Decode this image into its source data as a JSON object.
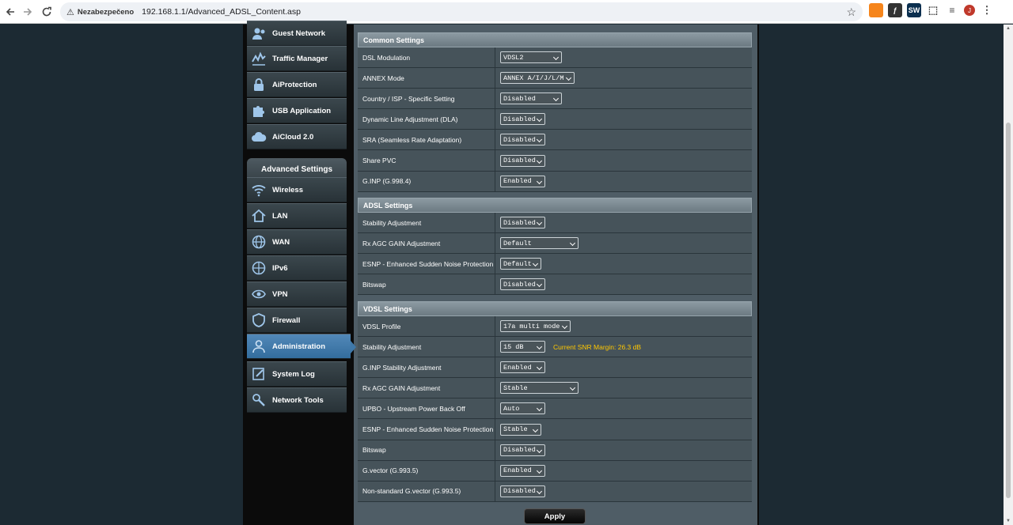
{
  "browser": {
    "security_label": "Nezabezpečeno",
    "url": "192.168.1.1/Advanced_ADSL_Content.asp",
    "avatar_initial": "J",
    "ext_labels": [
      "",
      "",
      "SW",
      "",
      ""
    ]
  },
  "sidebar": {
    "top_items": [
      {
        "label": "Guest Network",
        "icon": "guest-network-icon"
      },
      {
        "label": "Traffic Manager",
        "icon": "traffic-manager-icon"
      },
      {
        "label": "AiProtection",
        "icon": "lock-icon"
      },
      {
        "label": "USB Application",
        "icon": "puzzle-icon"
      },
      {
        "label": "AiCloud 2.0",
        "icon": "cloud-icon"
      }
    ],
    "advanced_header": "Advanced Settings",
    "advanced_items": [
      {
        "label": "Wireless",
        "icon": "wifi-icon"
      },
      {
        "label": "LAN",
        "icon": "home-icon"
      },
      {
        "label": "WAN",
        "icon": "globe-icon"
      },
      {
        "label": "IPv6",
        "icon": "ipv6-globe-icon"
      },
      {
        "label": "VPN",
        "icon": "vpn-icon"
      },
      {
        "label": "Firewall",
        "icon": "shield-icon"
      },
      {
        "label": "Administration",
        "icon": "user-icon",
        "active": true
      },
      {
        "label": "System Log",
        "icon": "log-icon"
      },
      {
        "label": "Network Tools",
        "icon": "wrench-icon"
      }
    ]
  },
  "common": {
    "title": "Common Settings",
    "rows": [
      {
        "label": "DSL Modulation",
        "value": "VDSL2"
      },
      {
        "label": "ANNEX Mode",
        "value": "ANNEX A/I/J/L/M"
      },
      {
        "label": "Country / ISP - Specific Setting",
        "value": "Disabled"
      },
      {
        "label": "Dynamic Line Adjustment (DLA)",
        "value": "Disabled"
      },
      {
        "label": "SRA (Seamless Rate Adaptation)",
        "value": "Disabled"
      },
      {
        "label": "Share PVC",
        "value": "Disabled"
      },
      {
        "label": "G.INP (G.998.4)",
        "value": "Enabled"
      }
    ]
  },
  "adsl": {
    "title": "ADSL Settings",
    "rows": [
      {
        "label": "Stability Adjustment",
        "value": "Disabled"
      },
      {
        "label": "Rx AGC GAIN Adjustment",
        "value": "Default"
      },
      {
        "label": "ESNP - Enhanced Sudden Noise Protection",
        "value": "Default"
      },
      {
        "label": "Bitswap",
        "value": "Disabled"
      }
    ]
  },
  "vdsl": {
    "title": "VDSL Settings",
    "rows": [
      {
        "label": "VDSL Profile",
        "value": "17a multi mode"
      },
      {
        "label": "Stability Adjustment",
        "value": "15 dB",
        "note": "Current SNR Margin: 26.3 dB"
      },
      {
        "label": "G.INP Stability Adjustment",
        "value": "Enabled"
      },
      {
        "label": "Rx AGC GAIN Adjustment",
        "value": "Stable"
      },
      {
        "label": "UPBO - Upstream Power Back Off",
        "value": "Auto"
      },
      {
        "label": "ESNP - Enhanced Sudden Noise Protection",
        "value": "Stable"
      },
      {
        "label": "Bitswap",
        "value": "Disabled"
      },
      {
        "label": "G.vector (G.993.5)",
        "value": "Enabled"
      },
      {
        "label": "Non-standard G.vector (G.993.5)",
        "value": "Disabled"
      }
    ]
  },
  "apply_label": "Apply",
  "colors": {
    "accent_active": "#3f78a9",
    "note_yellow": "#ffc700"
  }
}
